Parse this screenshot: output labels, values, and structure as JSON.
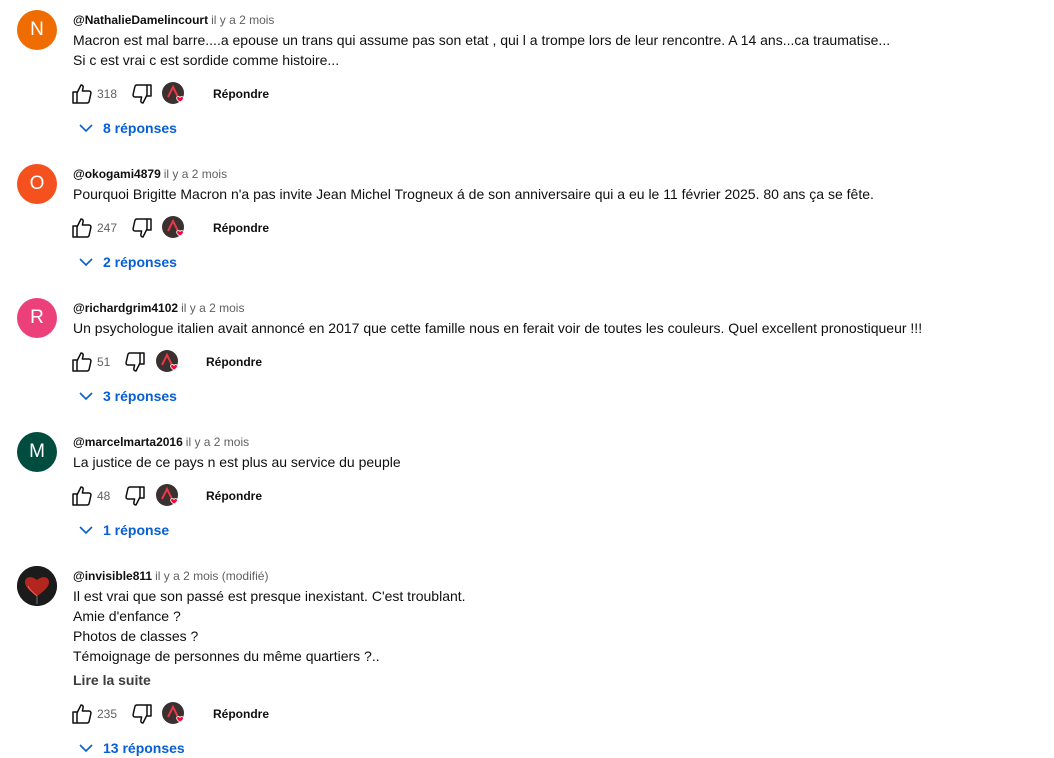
{
  "actions": {
    "reply_label": "Répondre"
  },
  "comments": [
    {
      "avatar_letter": "N",
      "avatar_color": "#ef6c00",
      "author": "@NathalieDamelincourt",
      "time": "il y a 2 mois",
      "lines": [
        "Macron est mal barre....a epouse un trans qui assume pas son etat , qui l a trompe lors de leur rencontre. A 14 ans...ca traumatise...",
        "Si c est vrai c est sordide comme histoire..."
      ],
      "likes": "318",
      "replies_label": "8 réponses"
    },
    {
      "avatar_letter": "O",
      "avatar_color": "#f4511e",
      "author": "@okogami4879",
      "time": "il y a 2 mois",
      "lines": [
        "Pourquoi Brigitte Macron n'a pas invite Jean Michel Trogneux á de son anniversaire qui a eu le 11 février 2025. 80 ans ça se fête."
      ],
      "likes": "247",
      "replies_label": "2 réponses"
    },
    {
      "avatar_letter": "R",
      "avatar_color": "#ec407a",
      "author": "@richardgrim4102",
      "time": "il y a 2 mois",
      "lines": [
        "Un psychologue italien avait annoncé en 2017 que cette famille nous en ferait  voir de toutes les couleurs. Quel excellent pronostiqueur !!!"
      ],
      "likes": "51",
      "replies_label": "3 réponses"
    },
    {
      "avatar_letter": "M",
      "avatar_color": "#004d40",
      "author": "@marcelmarta2016",
      "time": "il y a 2 mois",
      "lines": [
        "La justice de ce pays n est plus au service du peuple"
      ],
      "likes": "48",
      "replies_label": "1 réponse"
    },
    {
      "avatar_letter": "",
      "avatar_color": "#1b1b1b",
      "author": "@invisible811",
      "time": "il y a 2 mois (modifié)",
      "lines": [
        "Il est vrai que son passé est presque inexistant. C'est troublant.",
        "Amie d'enfance ?",
        "Photos de classes ?",
        "Témoignage de personnes du même quartiers ?.."
      ],
      "read_more": "Lire la suite",
      "likes": "235",
      "replies_label": "13 réponses"
    }
  ]
}
